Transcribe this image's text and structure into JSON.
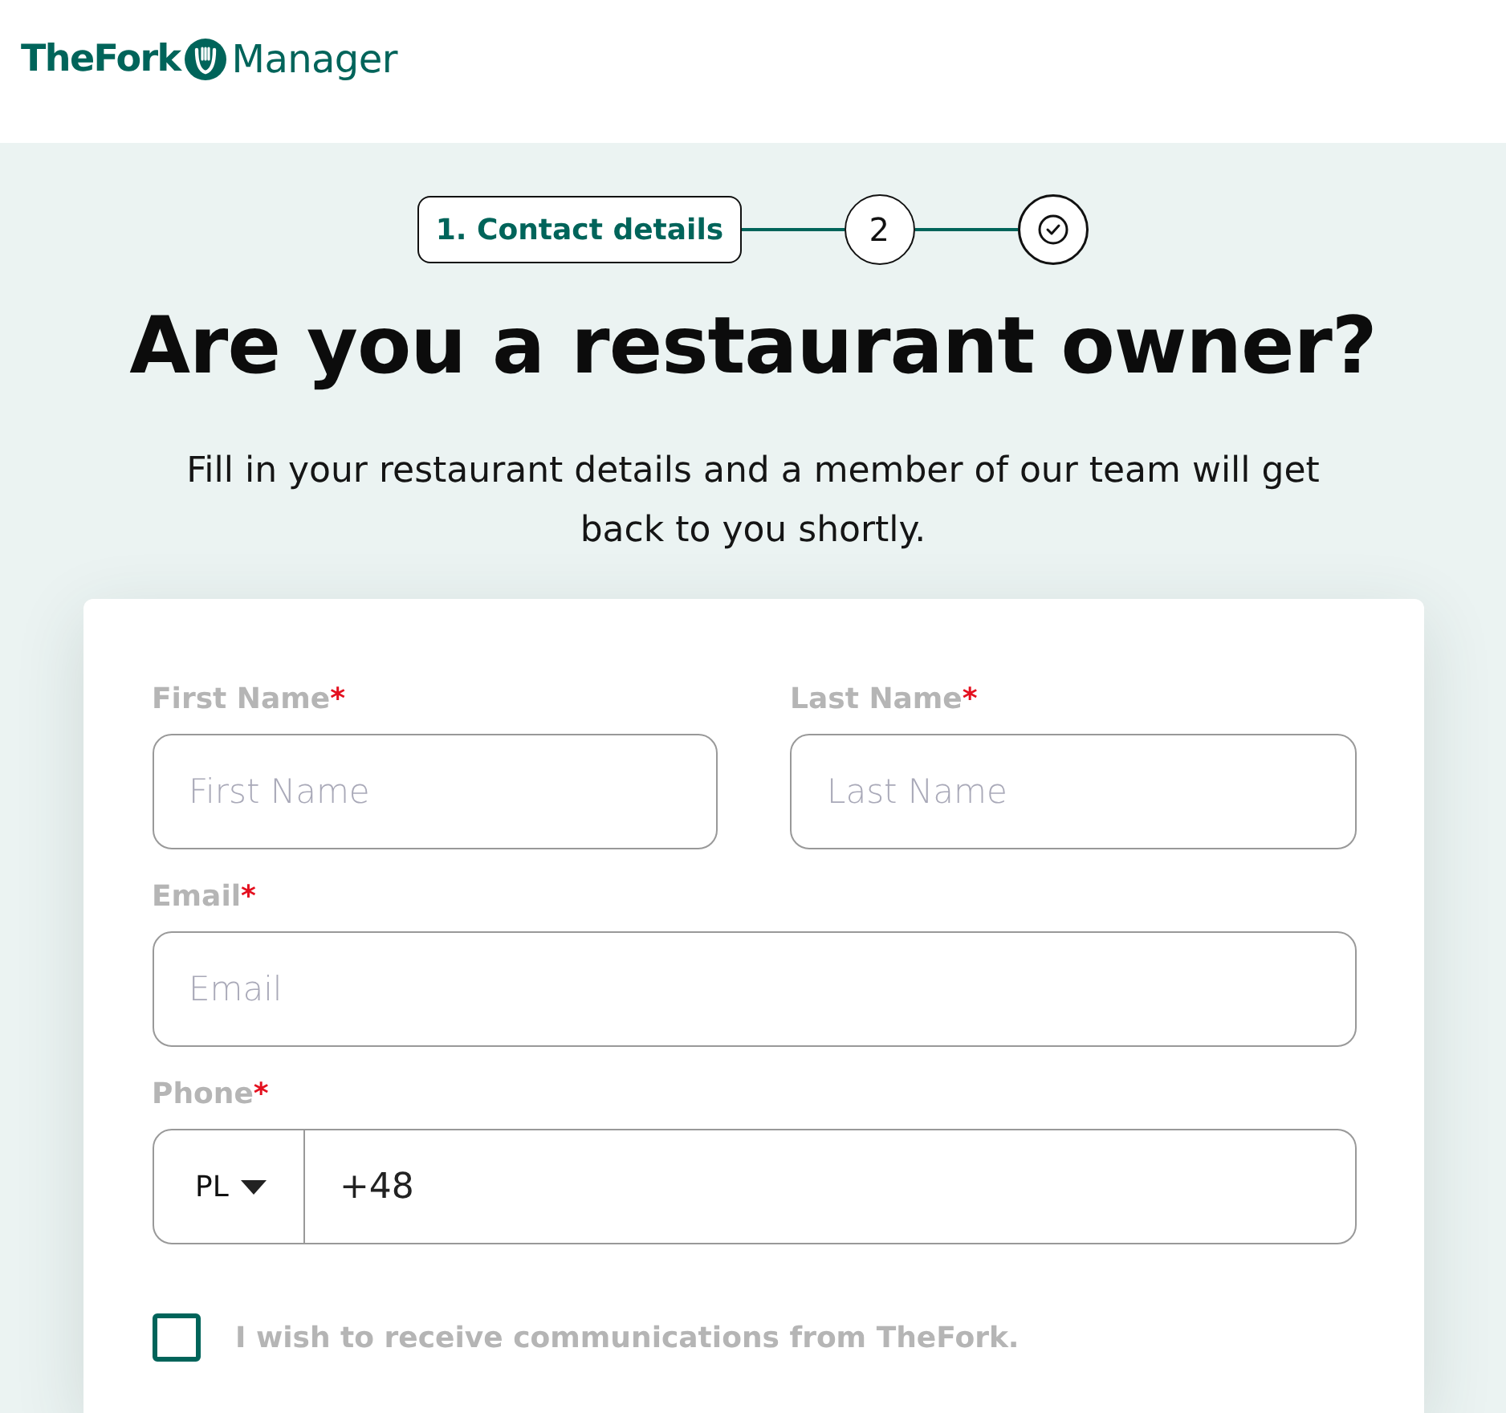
{
  "header": {
    "logo": {
      "brand": "TheFork",
      "product": "Manager"
    }
  },
  "stepper": {
    "steps": [
      {
        "kind": "label",
        "label": "1. Contact details",
        "selected": true
      },
      {
        "kind": "number",
        "label": "2",
        "selected": false
      },
      {
        "kind": "done",
        "selected": false
      }
    ]
  },
  "title": "Are you a restaurant owner?",
  "subtitle": "Fill in your restaurant details and a member of our team will get back to you shortly.",
  "form": {
    "rows": [
      [
        {
          "kind": "text",
          "label": "First Name",
          "mark": "*",
          "placeholder": "First Name"
        },
        {
          "kind": "text",
          "label": "Last Name",
          "mark": "*",
          "placeholder": "Last Name"
        }
      ],
      [
        {
          "kind": "text",
          "label": "Email",
          "mark": "*",
          "placeholder": "Email"
        }
      ],
      [
        {
          "kind": "phone",
          "label": "Phone",
          "mark": "*",
          "country": "PL",
          "value": "+48"
        }
      ]
    ],
    "consent": {
      "label": "I wish to receive communications from TheFork.",
      "checked": false
    }
  }
}
